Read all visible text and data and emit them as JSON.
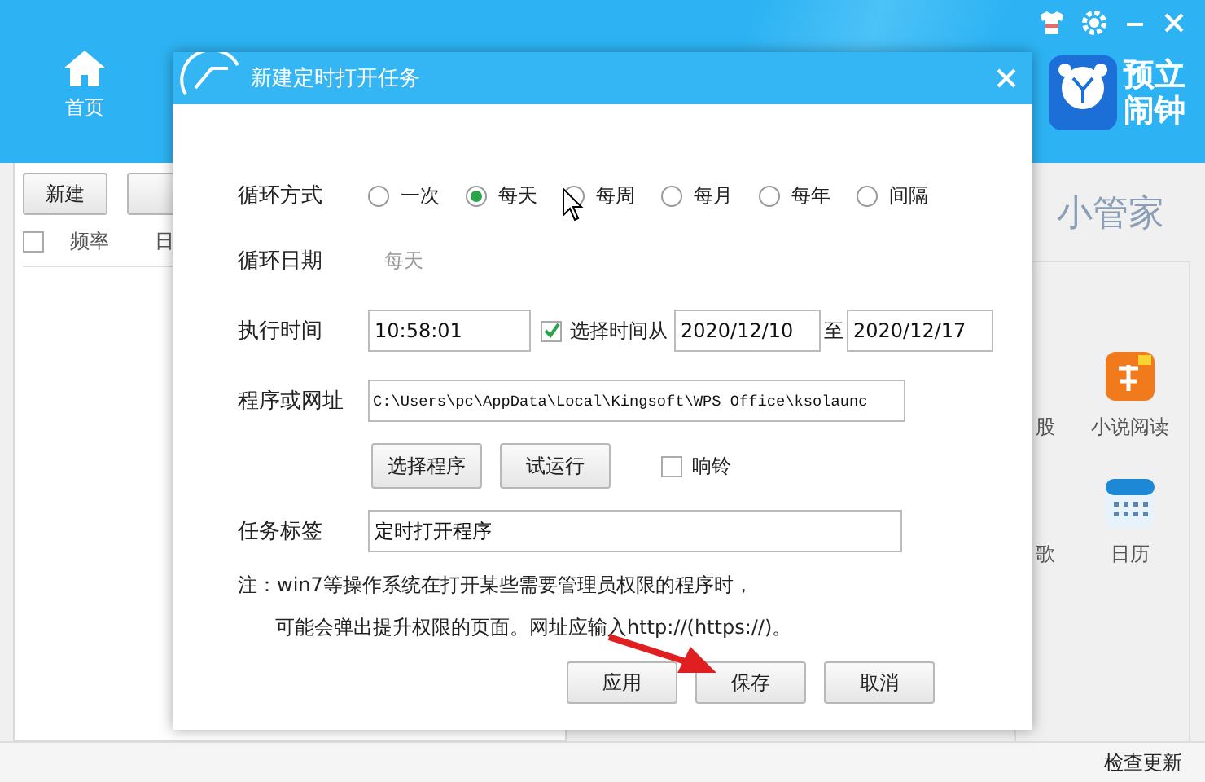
{
  "app": {
    "nav": [
      {
        "label": "首页",
        "selected": true
      }
    ],
    "logo_lines": [
      "预立",
      "闹钟"
    ],
    "toolbar": [
      "新建"
    ],
    "list_header": {
      "checked": false,
      "columns": [
        "频率",
        "日"
      ]
    },
    "side_title": "小管家",
    "apps": [
      {
        "label": "股",
        "kind": "partial"
      },
      {
        "label": "小说阅读",
        "kind": "novel"
      },
      {
        "label": "歌",
        "kind": "partial"
      },
      {
        "label": "日历",
        "kind": "calendar"
      }
    ],
    "status_bar": {
      "update_link": "检查更新"
    }
  },
  "dialog": {
    "title": "新建定时打开任务",
    "cycle": {
      "label": "循环方式",
      "options": [
        {
          "label": "一次",
          "selected": false
        },
        {
          "label": "每天",
          "selected": true
        },
        {
          "label": "每周",
          "selected": false
        },
        {
          "label": "每月",
          "selected": false
        },
        {
          "label": "每年",
          "selected": false
        },
        {
          "label": "间隔",
          "selected": false
        }
      ]
    },
    "cycle_date": {
      "label": "循环日期",
      "value": "每天"
    },
    "exec_time": {
      "label": "执行时间",
      "value": "10:58:01",
      "range_checked": true,
      "range_label": "选择时间从",
      "from": "2020/12/10",
      "to_label": "至",
      "to": "2020/12/17"
    },
    "program": {
      "label": "程序或网址",
      "value": "C:\\Users\\pc\\AppData\\Local\\Kingsoft\\WPS Office\\ksolaunc"
    },
    "program_buttons": [
      "选择程序",
      "试运行"
    ],
    "ring": {
      "label": "响铃",
      "checked": false
    },
    "task_label": {
      "label": "任务标签",
      "value": "定时打开程序"
    },
    "notes": [
      "注：win7等操作系统在打开某些需要管理员权限的程序时，",
      "可能会弹出提升权限的页面。网址应输入http://(https://)。"
    ],
    "buttons": [
      "应用",
      "保存",
      "取消"
    ]
  }
}
